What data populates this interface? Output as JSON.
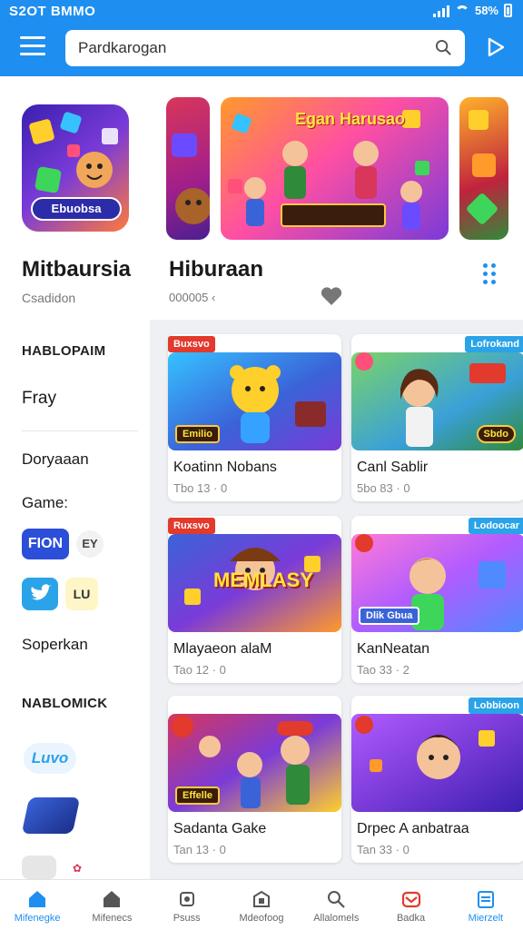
{
  "status_bar": {
    "time": "S2OT BMMO",
    "battery": "58%"
  },
  "search": {
    "value": "Pardkarogan",
    "placeholder": "Pardkarogan"
  },
  "featured_app": {
    "title": "Mitbaursia",
    "subtitle": "Csadidon",
    "badge": "Ebuobsa"
  },
  "featured_banner": {
    "title": "Hiburaan",
    "subtitle": "000005 ‹",
    "art_text": "Egan Harusao"
  },
  "sidebar": {
    "head1": "HABLOPAIM",
    "item_fray": "Fray",
    "item_doryaaan": "Doryaaan",
    "item_game": "Game:",
    "chip_fion": "FION",
    "chip_ey": "EY",
    "chip_lu": "LU",
    "item_soperkan": "Soperkan",
    "head2": "NABLOMICK",
    "logo_text": "Luvo"
  },
  "cards": [
    {
      "name": "Koatinn Nobans",
      "meta": "Tbo 13 · 0",
      "tag_left": "Buxsvo",
      "tag_right": "",
      "img_label": "Emilio"
    },
    {
      "name": "Canl Sablir",
      "meta": "5bo 83 · 0",
      "tag_left": "",
      "tag_right": "Lofrokand",
      "img_label": "Sbdo"
    },
    {
      "name": "Mlayaeon alaM",
      "meta": "Tao 12 · 0",
      "tag_left": "Ruxsvo",
      "tag_right": "",
      "img_label": "MEMLASY"
    },
    {
      "name": "KanNeatan",
      "meta": "Tao 33 · 2",
      "tag_left": "",
      "tag_right": "Lodoocar",
      "img_label": "Dlik Gbua"
    },
    {
      "name": "Sadanta Gake",
      "meta": "Tan 13 · 0",
      "tag_left": "",
      "tag_right": "",
      "img_label": "Effelle"
    },
    {
      "name": "Drpec A anbatraa",
      "meta": "Tan 33 · 0",
      "tag_left": "",
      "tag_right": "Lobbioon",
      "img_label": ""
    }
  ],
  "bottom_nav": [
    {
      "label": "Mifenegke",
      "icon": "home-icon"
    },
    {
      "label": "Mifenecs",
      "icon": "house-outline-icon"
    },
    {
      "label": "Psuss",
      "icon": "puzzle-icon"
    },
    {
      "label": "Mdeofoog",
      "icon": "box-icon"
    },
    {
      "label": "Allalomels",
      "icon": "search-icon"
    },
    {
      "label": "Badka",
      "icon": "mail-icon"
    },
    {
      "label": "Mierzelt",
      "icon": "calendar-icon"
    }
  ],
  "colors": {
    "accent": "#1e8ff0",
    "tag_red": "#e23a2c",
    "tag_blue": "#2aa3e8"
  }
}
